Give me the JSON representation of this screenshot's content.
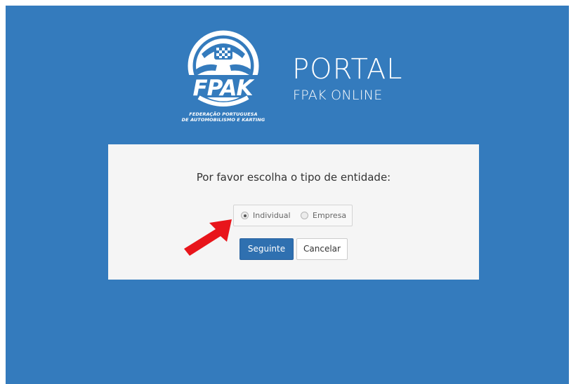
{
  "branding": {
    "logo_text": "FPAK",
    "logo_tagline_line1": "FEDERAÇÃO PORTUGUESA",
    "logo_tagline_line2": "DE AUTOMOBILISMO E KARTING",
    "portal_title": "PORTAL",
    "portal_subtitle": "FPAK ONLINE"
  },
  "form": {
    "prompt": "Por favor escolha o tipo de entidade:",
    "entity_options": [
      {
        "label": "Individual",
        "selected": true
      },
      {
        "label": "Empresa",
        "selected": false
      }
    ],
    "next_label": "Seguinte",
    "cancel_label": "Cancelar"
  },
  "colors": {
    "background": "#347bbd",
    "card": "#f5f5f5",
    "primary_button": "#2f70b0",
    "annotation_arrow": "#e8151b"
  },
  "annotation": {
    "icon": "red-arrow-icon"
  }
}
